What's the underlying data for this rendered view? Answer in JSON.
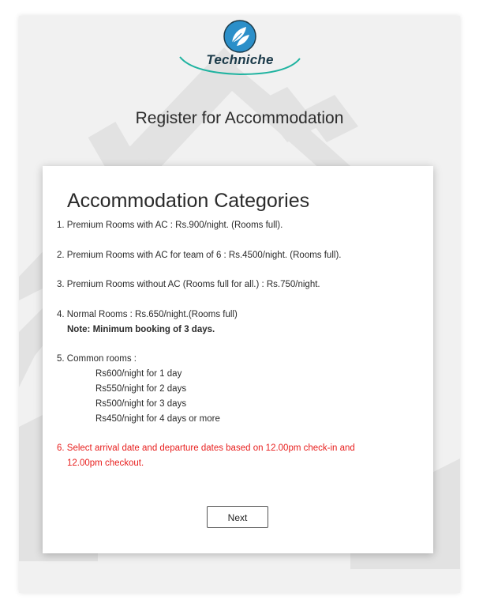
{
  "logo": {
    "text": "Techniche"
  },
  "page_title": "Register for Accommodation",
  "card": {
    "title": "Accommodation Categories",
    "items": [
      {
        "text": "1. Premium Rooms with AC : Rs.900/night. (Rooms full)."
      },
      {
        "text": "2. Premium Rooms with AC for team of 6 : Rs.4500/night. (Rooms full)."
      },
      {
        "text": "3. Premium Rooms without AC (Rooms full for all.) : Rs.750/night."
      },
      {
        "text": "4. Normal Rooms : Rs.650/night.(Rooms full)",
        "note": "Note: Minimum booking of 3 days."
      },
      {
        "text": "5. Common rooms :",
        "sub": [
          "Rs600/night for 1 day",
          "Rs550/night for 2 days",
          "Rs500/night for 3 days",
          "Rs450/night for 4 days or more"
        ]
      },
      {
        "text": "6. Select arrival date and departure dates based on 12.00pm check-in and",
        "cont": "12.00pm checkout."
      }
    ],
    "next_label": "Next"
  },
  "colors": {
    "accent_red": "#e8201f",
    "logo_teal": "#1fb3a0",
    "logo_blue": "#2b8fc9"
  }
}
